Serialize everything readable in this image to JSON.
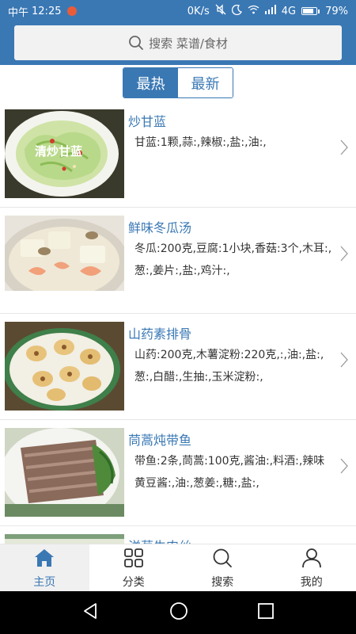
{
  "status_bar": {
    "carrier": "中午",
    "time": "12:25",
    "speed": "0K/s",
    "network": "4G",
    "battery": "79%",
    "battery_level": 0.79
  },
  "search": {
    "placeholder": "搜索 菜谱/食材"
  },
  "tabs": [
    {
      "label": "最热",
      "active": true
    },
    {
      "label": "最新",
      "active": false
    }
  ],
  "recipes": [
    {
      "title": "炒甘蓝",
      "ingredients": "甘蓝:1颗,蒜:,辣椒:,盐:,油:,",
      "image_caption": "清炒甘蓝"
    },
    {
      "title": "鲜味冬瓜汤",
      "ingredients": "冬瓜:200克,豆腐:1小块,香菇:3个,木耳:,葱:,姜片:,盐:,鸡汁:,"
    },
    {
      "title": "山药素排骨",
      "ingredients": "山药:200克,木薯淀粉:220克,:,油:,盐:,葱:,白醋:,生抽:,玉米淀粉:,"
    },
    {
      "title": "茼蒿炖带鱼",
      "ingredients": "带鱼:2条,茼蒿:100克,酱油:,料酒:,辣味黄豆酱:,油:,葱姜:,糖:,盐:,"
    },
    {
      "title": "洋葱牛肉丝",
      "ingredients": ""
    }
  ],
  "bottom_nav": [
    {
      "label": "主页",
      "icon": "home-icon",
      "active": true
    },
    {
      "label": "分类",
      "icon": "grid-icon",
      "active": false
    },
    {
      "label": "搜索",
      "icon": "search-icon",
      "active": false
    },
    {
      "label": "我的",
      "icon": "user-icon",
      "active": false
    }
  ],
  "colors": {
    "primary": "#3a78b4",
    "text": "#333333",
    "divider": "#e6e6e6"
  }
}
